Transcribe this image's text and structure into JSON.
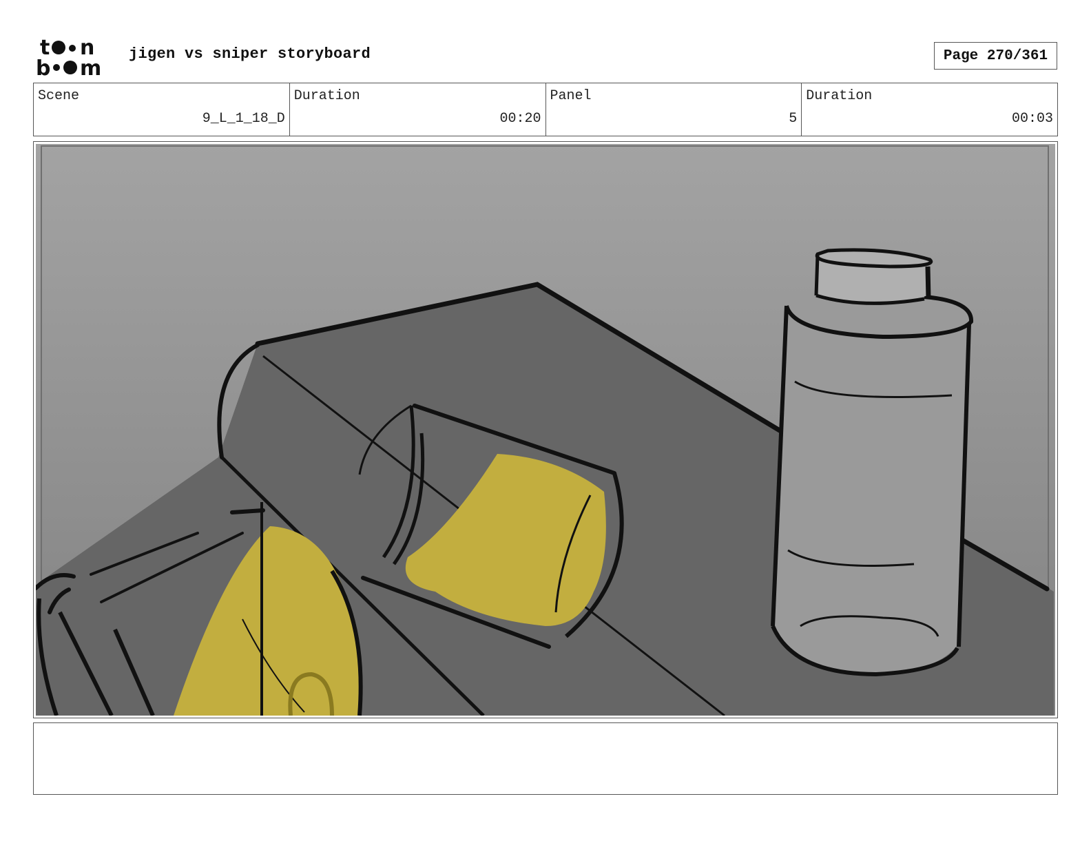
{
  "header": {
    "logo_text": "toon boom",
    "title": "jigen vs sniper storyboard",
    "page_label": "Page 270/361"
  },
  "info": [
    {
      "label": "Scene",
      "value": "9_L_1_18_D"
    },
    {
      "label": "Duration",
      "value": "00:20"
    },
    {
      "label": "Panel",
      "value": "5"
    },
    {
      "label": "Duration",
      "value": "00:03"
    }
  ],
  "panel": {
    "description": "",
    "colors": {
      "liquid": "#c2ae3f",
      "table": "#666666",
      "bottle": "#9a9a9a"
    }
  },
  "notes": {
    "text": ""
  }
}
